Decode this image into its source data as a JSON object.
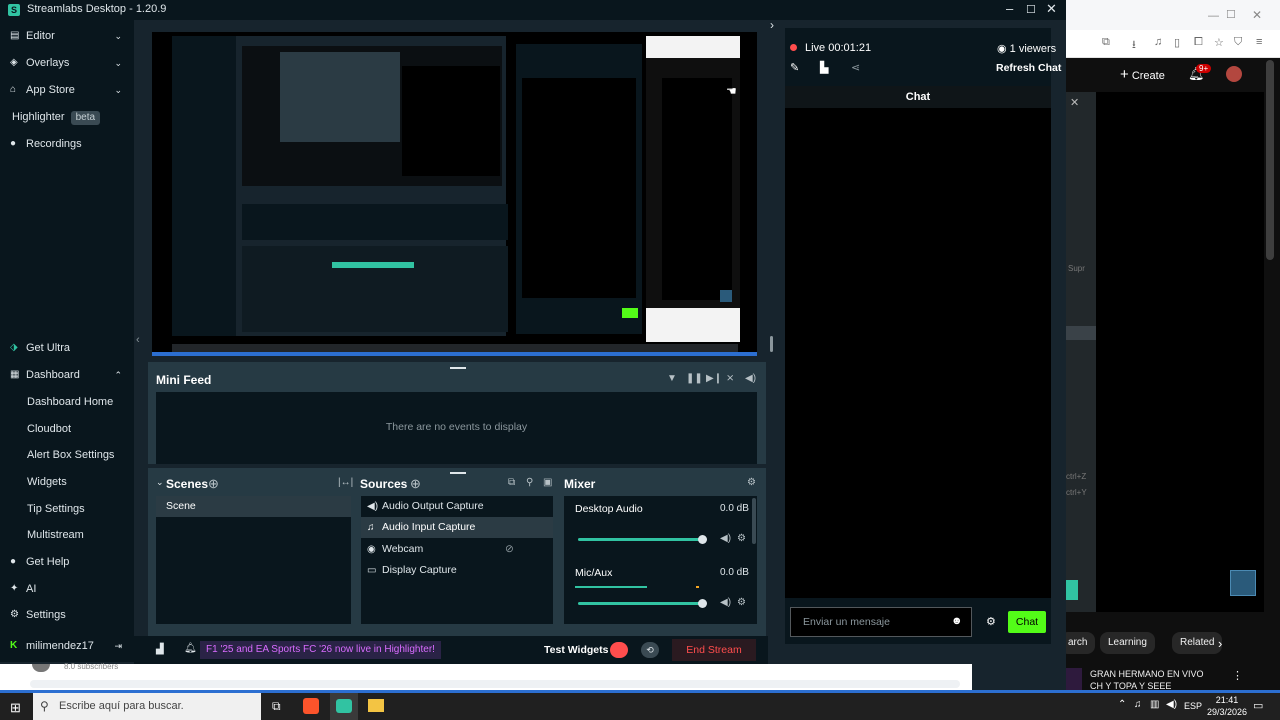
{
  "window": {
    "title": "Streamlabs Desktop - 1.20.9"
  },
  "nav": {
    "top": [
      {
        "label": "Editor",
        "icon": "editor-icon",
        "chevron": "⌄"
      },
      {
        "label": "Overlays",
        "icon": "overlays-icon",
        "chevron": "⌄"
      },
      {
        "label": "App Store",
        "icon": "app-store-icon",
        "chevron": "⌄"
      },
      {
        "label": "Highlighter",
        "icon": "highlighter-icon",
        "badge": "beta"
      },
      {
        "label": "Recordings",
        "icon": "recordings-icon"
      }
    ],
    "get_ultra": "Get Ultra",
    "dashboard": "Dashboard",
    "dashboard_items": [
      "Dashboard Home",
      "Cloudbot",
      "Alert Box Settings",
      "Widgets",
      "Tip Settings",
      "Multistream"
    ],
    "get_help": "Get Help",
    "ai": "AI",
    "settings": "Settings",
    "user": "milimendez17"
  },
  "minifeed": {
    "title": "Mini Feed",
    "empty": "There are no events to display"
  },
  "scenes": {
    "title": "Scenes",
    "items": [
      "Scene"
    ]
  },
  "sources": {
    "title": "Sources",
    "items": [
      "Audio Output Capture",
      "Audio Input Capture",
      "Webcam",
      "Display Capture"
    ]
  },
  "mixer": {
    "title": "Mixer",
    "channels": [
      {
        "name": "Desktop Audio",
        "level": "0.0 dB"
      },
      {
        "name": "Mic/Aux",
        "level": "0.0 dB"
      }
    ]
  },
  "footer": {
    "banner": "F1 '25 and EA Sports FC '26 now live in Highlighter!",
    "test_widgets": "Test Widgets",
    "end_stream": "End Stream"
  },
  "chat": {
    "live": "Live",
    "timer": "00:01:21",
    "viewers": "1 viewers",
    "refresh": "Refresh Chat",
    "title": "Chat",
    "placeholder": "Enviar un mensaje",
    "send": "Chat"
  },
  "browser": {
    "create": "Create",
    "notif": "9+",
    "chips": [
      "arch",
      "Learning",
      "Related"
    ],
    "video_title_1": "GRAN HERMANO EN VIVO",
    "video_title_2": "CH Y TOPA Y SEEE",
    "side_1": "Supr",
    "side_2": "ctrl+Z",
    "side_3": "ctrl+Y",
    "subs": "8.0 subscribers"
  },
  "taskbar": {
    "search": "Escribe aquí para buscar.",
    "lang": "ESP",
    "time": "21:41",
    "date": "29/3/2026"
  },
  "colors": {
    "accent": "#31c3a2",
    "chat_green": "#53fc18",
    "end_stream": "#ff4d4d",
    "banner": "#d96cff"
  }
}
